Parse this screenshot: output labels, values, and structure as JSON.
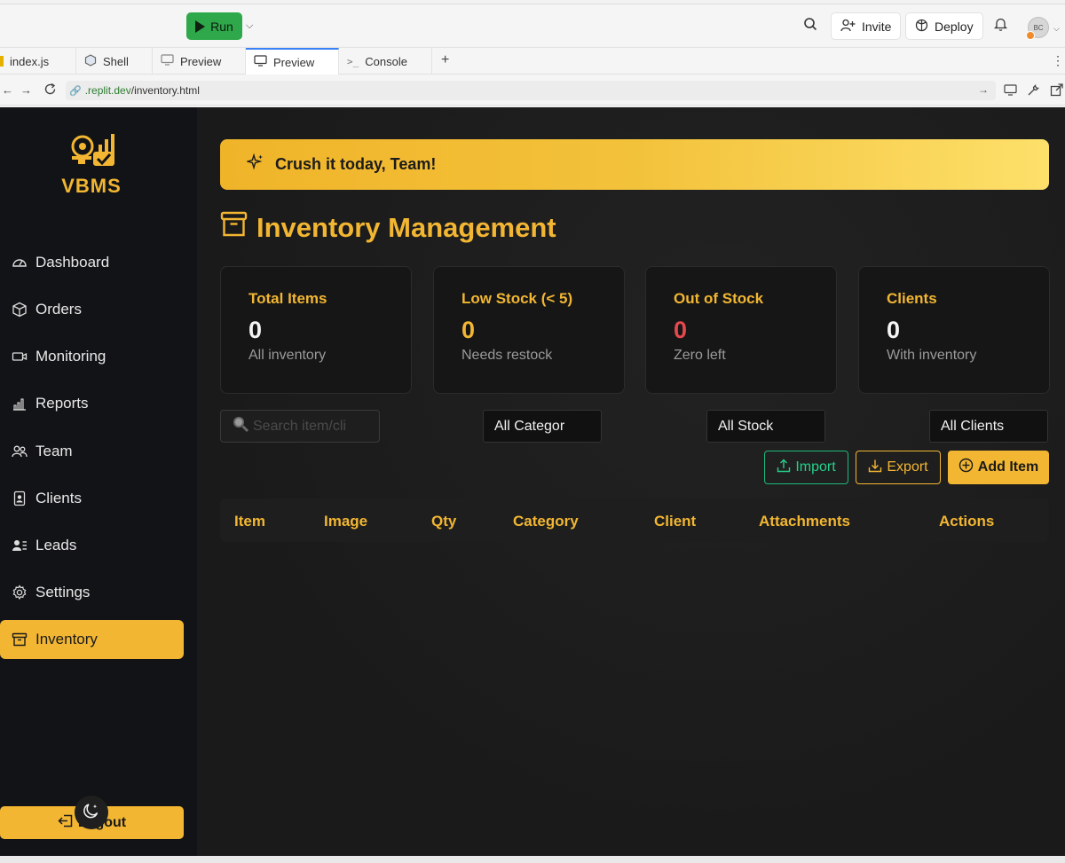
{
  "toolbar": {
    "run_label": "Run",
    "invite_label": "Invite",
    "deploy_label": "Deploy",
    "avatar_initials": "BC"
  },
  "tabs": [
    {
      "label": "index.js",
      "icon": "js-file-icon"
    },
    {
      "label": "Shell",
      "icon": "shell-icon"
    },
    {
      "label": "Preview",
      "icon": "monitor-icon"
    },
    {
      "label": "Preview",
      "icon": "monitor-icon",
      "active": true
    },
    {
      "label": "Console",
      "icon": "console-icon"
    }
  ],
  "urlbar": {
    "host": ".replit.dev",
    "path": "/inventory.html"
  },
  "sidebar": {
    "brand": "VBMS",
    "items": [
      {
        "label": "Dashboard",
        "icon": "dashboard-icon"
      },
      {
        "label": "Orders",
        "icon": "box-icon"
      },
      {
        "label": "Monitoring",
        "icon": "camera-icon"
      },
      {
        "label": "Reports",
        "icon": "bar-chart-icon"
      },
      {
        "label": "Team",
        "icon": "team-icon"
      },
      {
        "label": "Clients",
        "icon": "id-badge-icon"
      },
      {
        "label": "Leads",
        "icon": "user-list-icon"
      },
      {
        "label": "Settings",
        "icon": "gear-icon"
      },
      {
        "label": "Inventory",
        "icon": "archive-icon",
        "active": true
      }
    ],
    "logout_label": "Logout"
  },
  "banner": {
    "text": "Crush it today, Team!"
  },
  "page": {
    "title": "Inventory Management"
  },
  "stats": [
    {
      "title": "Total Items",
      "value": "0",
      "sub": "All inventory"
    },
    {
      "title": "Low Stock (< 5)",
      "value": "0",
      "sub": "Needs restock"
    },
    {
      "title": "Out of Stock",
      "value": "0",
      "sub": "Zero left"
    },
    {
      "title": "Clients",
      "value": "0",
      "sub": "With inventory"
    }
  ],
  "filters": {
    "search_placeholder": "Search item/cli",
    "category": "All Categor",
    "stock": "All Stock",
    "clients": "All Clients"
  },
  "actions": {
    "import": "Import",
    "export": "Export",
    "add": "Add Item"
  },
  "table": {
    "columns": [
      "Item",
      "Image",
      "Qty",
      "Category",
      "Client",
      "Attachments",
      "Actions"
    ]
  },
  "colors": {
    "accent": "#f2b632",
    "danger": "#e5484d",
    "success": "#25d08a",
    "sidebar_bg": "#121316",
    "main_bg": "#1a1a1a"
  }
}
